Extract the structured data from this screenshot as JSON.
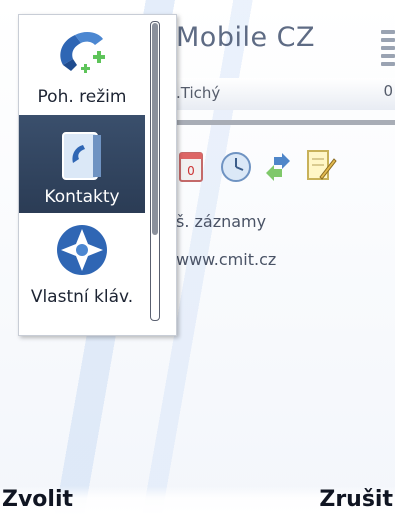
{
  "home": {
    "operator": "Mobile CZ",
    "profile": ".Tichý",
    "profile_tail": "0",
    "shortcuts": [
      {
        "icon": "calendar-icon"
      },
      {
        "icon": "clock-icon"
      },
      {
        "icon": "sync-icon"
      },
      {
        "icon": "notes-icon"
      }
    ],
    "missed_text": "š. záznamy",
    "web_text": "www.cmit.cz"
  },
  "menu": {
    "items": [
      {
        "label": "Poh. režim",
        "icon": "phone-mode-icon"
      },
      {
        "label": "Kontakty",
        "icon": "contacts-icon",
        "selected": true
      },
      {
        "label": "Vlastní kláv.",
        "icon": "navi-key-icon"
      }
    ]
  },
  "softkeys": {
    "left": "Zvolit",
    "right": "Zrušit"
  }
}
